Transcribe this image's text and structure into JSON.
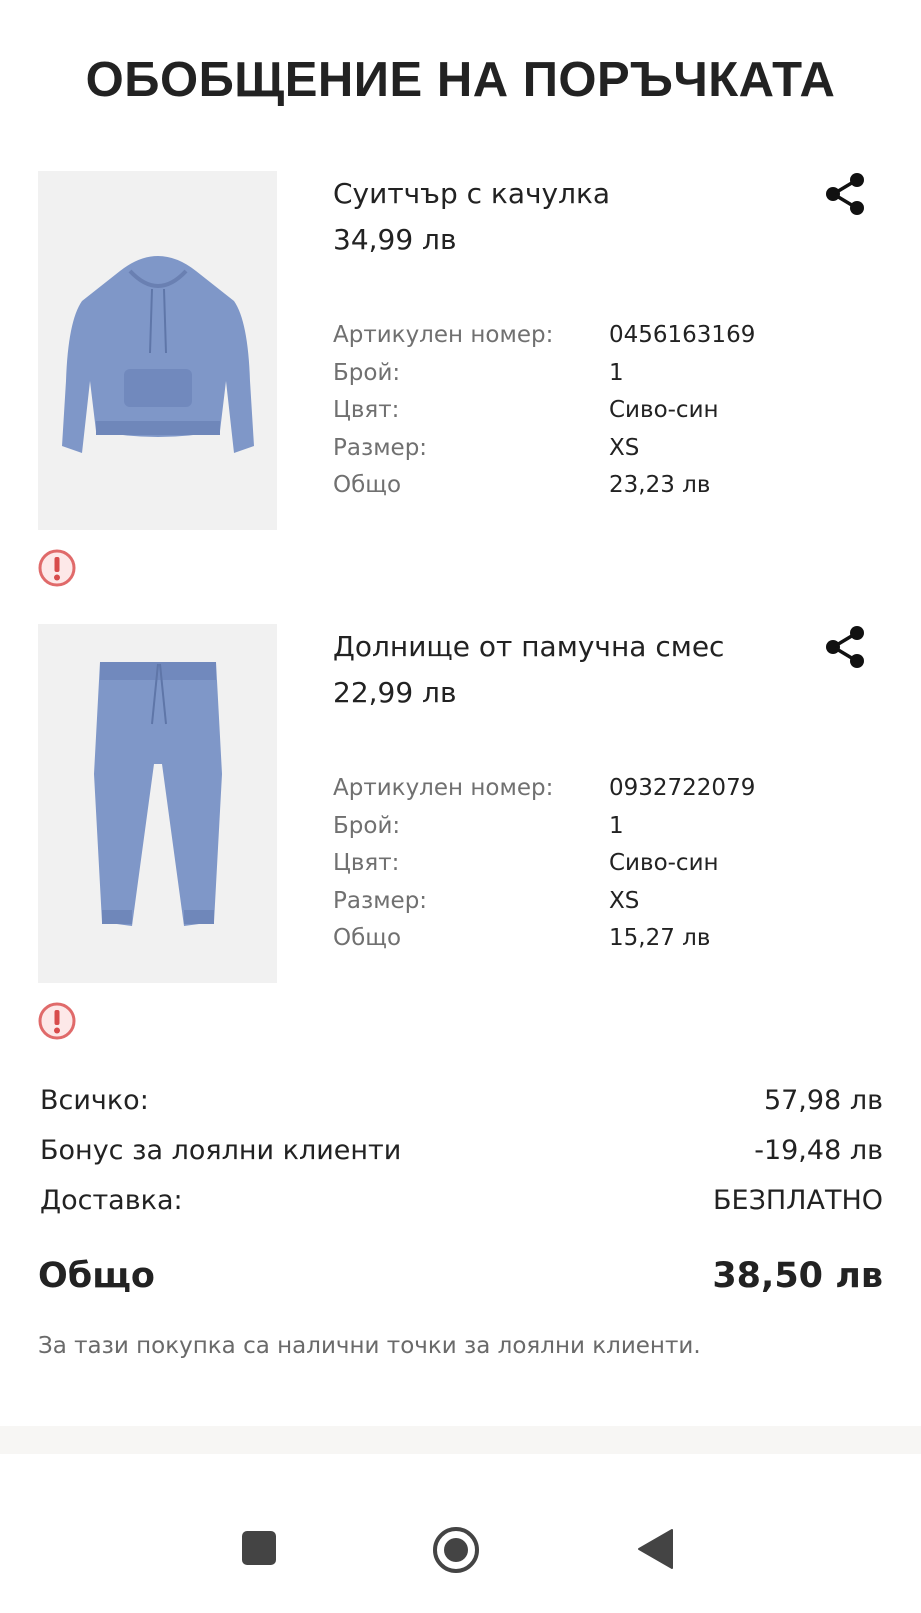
{
  "page": {
    "title": "ОБОБЩЕНИЕ НА ПОРЪЧКАТА"
  },
  "colors": {
    "alert": "#e06a6a",
    "text": "#222222",
    "muted": "#707070",
    "product_blue": "#7f97c8"
  },
  "products": [
    {
      "name": "Суитчър с качулка",
      "price": "34,99 лв",
      "image_icon": "hoodie-image",
      "details": [
        {
          "label": "Артикулен номер:",
          "value": "0456163169"
        },
        {
          "label": "Брой:",
          "value": "1"
        },
        {
          "label": "Цвят:",
          "value": "Сиво-син"
        },
        {
          "label": "Размер:",
          "value": "XS"
        },
        {
          "label": "Общо",
          "value": "23,23 лв"
        }
      ]
    },
    {
      "name": "Долнище от памучна смес",
      "price": "22,99 лв",
      "image_icon": "sweatpants-image",
      "details": [
        {
          "label": "Артикулен номер:",
          "value": "0932722079"
        },
        {
          "label": "Брой:",
          "value": "1"
        },
        {
          "label": "Цвят:",
          "value": "Сиво-син"
        },
        {
          "label": "Размер:",
          "value": "XS"
        },
        {
          "label": "Общо",
          "value": "15,27 лв"
        }
      ]
    }
  ],
  "summary": {
    "subtotal": {
      "label": "Всичко:",
      "value": "57,98 лв"
    },
    "loyalty_bonus": {
      "label": "Бонус за лоялни клиенти",
      "value": "-19,48 лв"
    },
    "delivery": {
      "label": "Доставка:",
      "value": "БЕЗПЛАТНО"
    },
    "total": {
      "label": "Общо",
      "value": "38,50 лв"
    },
    "loyalty_note": "За тази покупка са налични точки за лоялни клиенти."
  },
  "navbar": {
    "icons": [
      "recent-apps-icon",
      "home-icon",
      "back-icon"
    ]
  }
}
